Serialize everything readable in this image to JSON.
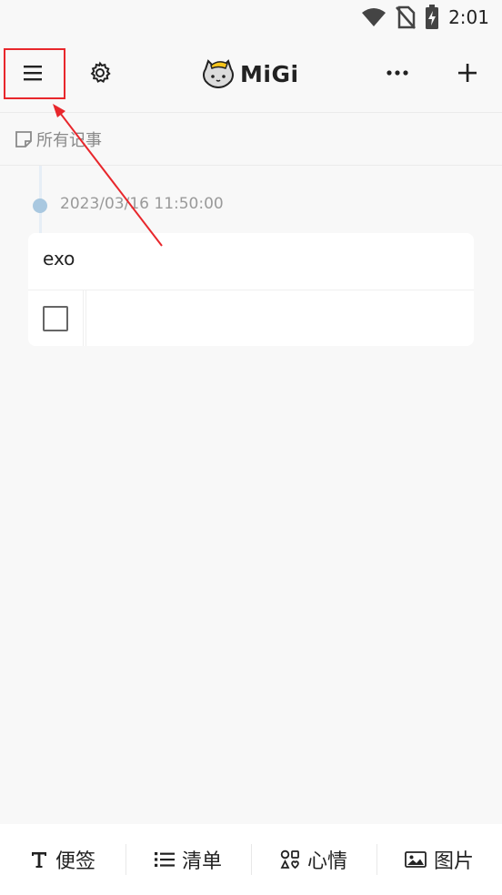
{
  "status_bar": {
    "time": "2:01",
    "icons": [
      "wifi-icon",
      "no-sim-icon",
      "battery-charging-icon"
    ]
  },
  "header": {
    "logo_text": "MiGi",
    "icons": [
      "menu-icon",
      "gear-icon",
      "more-icon",
      "plus-icon",
      "cat-mascot-icon"
    ]
  },
  "category": {
    "label": "所有记事",
    "icon": "note-icon"
  },
  "timeline": {
    "date": "2023/03/16 11:50:00"
  },
  "note": {
    "title": "exo",
    "checklist": [
      {
        "checked": false,
        "text": ""
      }
    ]
  },
  "toolbar": {
    "items": [
      {
        "icon": "text-icon",
        "label": "便签"
      },
      {
        "icon": "list-icon",
        "label": "清单"
      },
      {
        "icon": "mood-icon",
        "label": "心情"
      },
      {
        "icon": "image-icon",
        "label": "图片"
      }
    ]
  },
  "colors": {
    "annotation": "#e8272c",
    "timeline_dot": "#a9c8e0",
    "background": "#f8f8f8"
  }
}
